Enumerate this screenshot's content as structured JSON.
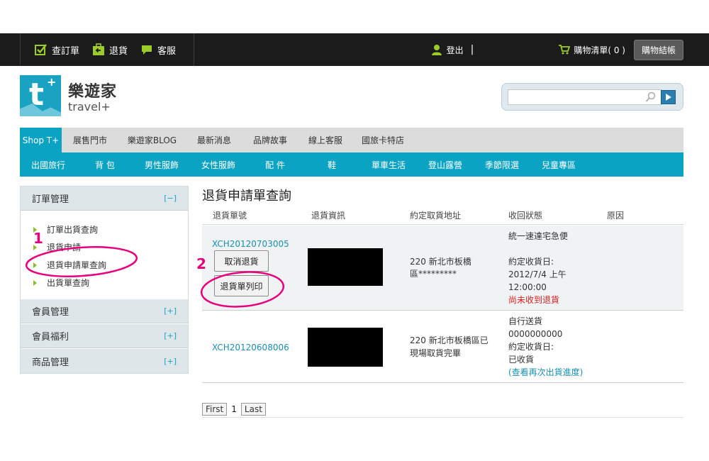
{
  "topbar": {
    "check_order": "查訂單",
    "return": "退貨",
    "service": "客服",
    "logout": "登出",
    "separator": "|",
    "cart": "購物清單( 0 )",
    "checkout": "購物結帳"
  },
  "brand": {
    "logo_mark": "t",
    "logo_plus": "+",
    "name_cn": "樂遊家",
    "name_en": "travel+"
  },
  "search": {
    "placeholder": ""
  },
  "nav_primary": [
    {
      "label": "Shop T+",
      "active": true
    },
    {
      "label": "展售門市"
    },
    {
      "label": "樂遊家BLOG"
    },
    {
      "label": "最新消息"
    },
    {
      "label": "品牌故事"
    },
    {
      "label": "線上客服"
    },
    {
      "label": "國旅卡特店"
    }
  ],
  "nav_secondary": [
    {
      "label": "出國旅行"
    },
    {
      "label": "背 包"
    },
    {
      "label": "男性服飾"
    },
    {
      "label": "女性服飾"
    },
    {
      "label": "配 件"
    },
    {
      "label": "鞋"
    },
    {
      "label": "單車生活"
    },
    {
      "label": "登山露營"
    },
    {
      "label": "季節限選"
    },
    {
      "label": "兒童專區"
    }
  ],
  "sidebar": {
    "order_mgmt": {
      "title": "訂單管理",
      "toggle": "[−]"
    },
    "items": [
      {
        "label": "訂單出貨查詢"
      },
      {
        "label": "退貨申請"
      },
      {
        "label": "退貨申請單查詢"
      },
      {
        "label": "出貨單查詢"
      }
    ],
    "sections": [
      {
        "title": "會員管理",
        "toggle": "[+]"
      },
      {
        "title": "會員福利",
        "toggle": "[+]"
      },
      {
        "title": "商品管理",
        "toggle": "[+]"
      }
    ]
  },
  "main": {
    "title": "退貨申請單查詢",
    "columns": [
      "退貨單號",
      "退貨資訊",
      "約定取貨地址",
      "收回狀態",
      "原因"
    ],
    "rows": [
      {
        "order_no": "XCH20120703005",
        "cancel_btn": "取消退貨",
        "print_btn": "退貨單列印",
        "address_line1": "220 新北市板橋",
        "address_line2": "區*********",
        "status_line1": "統一速達宅急便",
        "status_line2": "約定收貨日:",
        "status_line3": "2012/7/4 上午",
        "status_line4": "12:00:00",
        "status_alert": "尚未收到退貨"
      },
      {
        "order_no": "XCH20120608006",
        "address_line1": "220 新北市板橋區已",
        "address_line2": "現場取貨完畢",
        "status_line1": "自行送貨",
        "status_line2": "0000000000",
        "status_line3": "約定收貨日:",
        "status_line4": "已收貨",
        "status_link": "(查看再次出貨進度)"
      }
    ]
  },
  "pager": {
    "first": "First",
    "current": "1",
    "last": "Last"
  },
  "annotations": {
    "num1": "1",
    "num2": "2",
    "color": "#e6007e"
  },
  "colors": {
    "brand": "#0ba3c4",
    "topbar": "#1b1b1b",
    "alert": "#d41e1e"
  }
}
